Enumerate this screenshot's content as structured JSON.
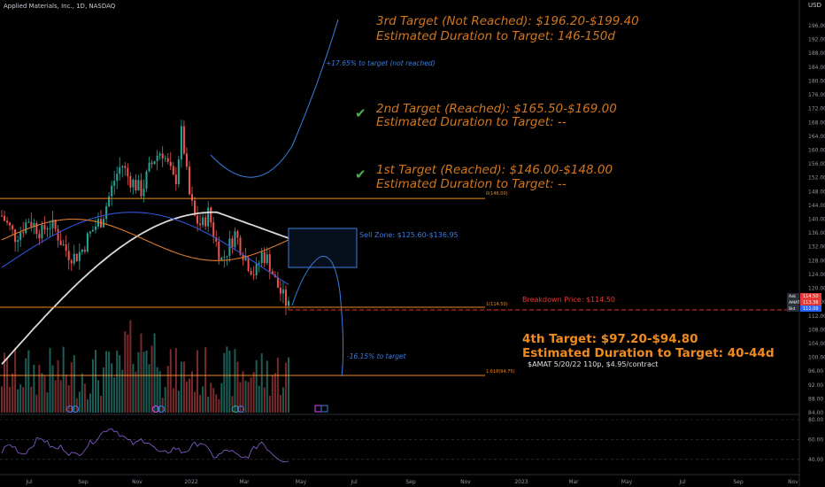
{
  "header": {
    "symbol_line": "Applied Materials, Inc., 1D, NASDAQ",
    "currency": "USD"
  },
  "colors": {
    "background": "#000000",
    "orange": "#f08a1d",
    "orange_text": "#d2761e",
    "blue_text": "#3b7de0",
    "red_level": "#e53935",
    "green_check": "#4caf50",
    "candle_up": "#26a69a",
    "candle_down": "#ef5350"
  },
  "annotations": {
    "target3": {
      "line1": "3rd Target (Not Reached): $196.20-$199.40",
      "line2": "Estimated Duration to Target: 146-150d"
    },
    "target2": {
      "line1": "2nd Target (Reached): $165.50-$169.00",
      "line2": "Estimated Duration to Target: --"
    },
    "target1": {
      "line1": "1st Target (Reached): $146.00-$148.00",
      "line2": "Estimated Duration to Target: --"
    },
    "target4": {
      "line1": "4th Target: $97.20-$94.80",
      "line2": "Estimated Duration to Target: 40-44d",
      "line3": "$AMAT 5/20/22 110p, $4.95/contract"
    },
    "up_move": "+17.65% to target (not reached)",
    "down_move": "-16.15% to target",
    "sell_zone": "Sell Zone: $125.60-$136.95",
    "breakdown": "Breakdown Price: $114.50",
    "fib0": "0(146.00)",
    "fib1": "1(114.50)",
    "fib1618": "1.618(94.75)"
  },
  "price_badges": [
    {
      "tag": "Ask",
      "value": "114.50",
      "color": "#e53935"
    },
    {
      "tag": "AMAT",
      "value": "113.36",
      "color": "#e53935"
    },
    {
      "tag": "Bid",
      "value": "111.00",
      "color": "#2962ff"
    }
  ],
  "chart_data": {
    "type": "candlestick",
    "title": "Applied Materials, Inc., 1D, NASDAQ",
    "x_ticks": [
      "Jul",
      "Sep",
      "Nov",
      "2022",
      "Mar",
      "May",
      "Jul",
      "Sep",
      "Nov",
      "2023",
      "Mar",
      "May",
      "Jul",
      "Sep",
      "Nov"
    ],
    "y_ticks": [
      196,
      192,
      188,
      184,
      180,
      176,
      172,
      168,
      164,
      160,
      156,
      152,
      148,
      144,
      140,
      136,
      132,
      128,
      124,
      120,
      116,
      112,
      108,
      104,
      100,
      96,
      92,
      88,
      84
    ],
    "ylim": [
      82,
      200
    ],
    "levels": {
      "fib_0": 146.0,
      "fib_1": 114.5,
      "fib_1618": 94.75,
      "sell_zone": [
        125.6,
        136.95
      ]
    },
    "approx_closes": [
      141,
      138,
      135,
      137,
      140,
      138,
      136,
      139,
      137,
      133,
      130,
      129,
      131,
      135,
      138,
      140,
      146,
      152,
      156,
      152,
      150,
      148,
      154,
      158,
      160,
      155,
      150,
      166,
      148,
      140,
      138,
      142,
      134,
      128,
      132,
      136,
      131,
      127,
      124,
      130,
      128,
      122,
      118,
      114.5
    ],
    "rsi_ticks": [
      80,
      60,
      40
    ],
    "rsi_approx": [
      48,
      55,
      52,
      45,
      50,
      58,
      62,
      55,
      50,
      53,
      47,
      44,
      48,
      55,
      60,
      66,
      72,
      70,
      64,
      58,
      55,
      60,
      58,
      50,
      45,
      48,
      52,
      47,
      50,
      55,
      58,
      48,
      42,
      46,
      50,
      45,
      40,
      44,
      52,
      58,
      50,
      44,
      40,
      38
    ]
  }
}
